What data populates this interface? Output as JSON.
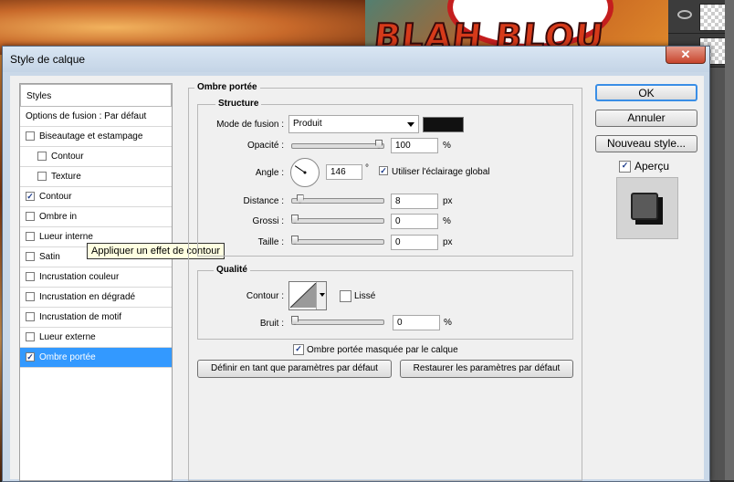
{
  "background": {
    "logo_text": "BLAH BLOU"
  },
  "dialog": {
    "title": "Style de calque",
    "close_glyph": "✕"
  },
  "style_list": {
    "header": "Styles",
    "items": [
      {
        "label": "Options de fusion : Par défaut",
        "checkbox": false,
        "checked": false,
        "indent": false,
        "selected": false
      },
      {
        "label": "Biseautage et estampage",
        "checkbox": true,
        "checked": false,
        "indent": false,
        "selected": false
      },
      {
        "label": "Contour",
        "checkbox": true,
        "checked": false,
        "indent": true,
        "selected": false
      },
      {
        "label": "Texture",
        "checkbox": true,
        "checked": false,
        "indent": true,
        "selected": false
      },
      {
        "label": "Contour",
        "checkbox": true,
        "checked": true,
        "indent": false,
        "selected": false
      },
      {
        "label": "Ombre in",
        "checkbox": true,
        "checked": false,
        "indent": false,
        "selected": false
      },
      {
        "label": "Lueur interne",
        "checkbox": true,
        "checked": false,
        "indent": false,
        "selected": false
      },
      {
        "label": "Satin",
        "checkbox": true,
        "checked": false,
        "indent": false,
        "selected": false
      },
      {
        "label": "Incrustation couleur",
        "checkbox": true,
        "checked": false,
        "indent": false,
        "selected": false
      },
      {
        "label": "Incrustation en dégradé",
        "checkbox": true,
        "checked": false,
        "indent": false,
        "selected": false
      },
      {
        "label": "Incrustation de motif",
        "checkbox": true,
        "checked": false,
        "indent": false,
        "selected": false
      },
      {
        "label": "Lueur externe",
        "checkbox": true,
        "checked": false,
        "indent": false,
        "selected": false
      },
      {
        "label": "Ombre portée",
        "checkbox": true,
        "checked": true,
        "indent": false,
        "selected": true
      }
    ],
    "tooltip": "Appliquer un effet de contour"
  },
  "panel": {
    "title": "Ombre portée",
    "structure": {
      "title": "Structure",
      "blend_mode_label": "Mode de fusion :",
      "blend_mode_value": "Produit",
      "shadow_color": "#111111",
      "opacity_label": "Opacité :",
      "opacity_value": "100",
      "opacity_unit": "%",
      "opacity_level": 1.0,
      "angle_label": "Angle :",
      "angle_value": "146",
      "angle_unit": "°",
      "global_light_label": "Utiliser l'éclairage global",
      "global_light_checked": true,
      "distance_label": "Distance :",
      "distance_value": "8",
      "distance_unit": "px",
      "distance_level": 0.06,
      "spread_label": "Grossi :",
      "spread_value": "0",
      "spread_unit": "%",
      "spread_level": 0,
      "size_label": "Taille :",
      "size_value": "0",
      "size_unit": "px",
      "size_level": 0
    },
    "quality": {
      "title": "Qualité",
      "contour_label": "Contour :",
      "antialias_label": "Lissé",
      "antialias_checked": false,
      "noise_label": "Bruit :",
      "noise_value": "0",
      "noise_unit": "%",
      "noise_level": 0
    },
    "knockout_label": "Ombre portée masquée par le calque",
    "knockout_checked": true,
    "make_default_button": "Définir en tant que paramètres par défaut",
    "reset_default_button": "Restaurer les paramètres par défaut"
  },
  "side_buttons": {
    "ok": "OK",
    "cancel": "Annuler",
    "new_style": "Nouveau style...",
    "preview_label": "Aperçu",
    "preview_checked": true
  }
}
